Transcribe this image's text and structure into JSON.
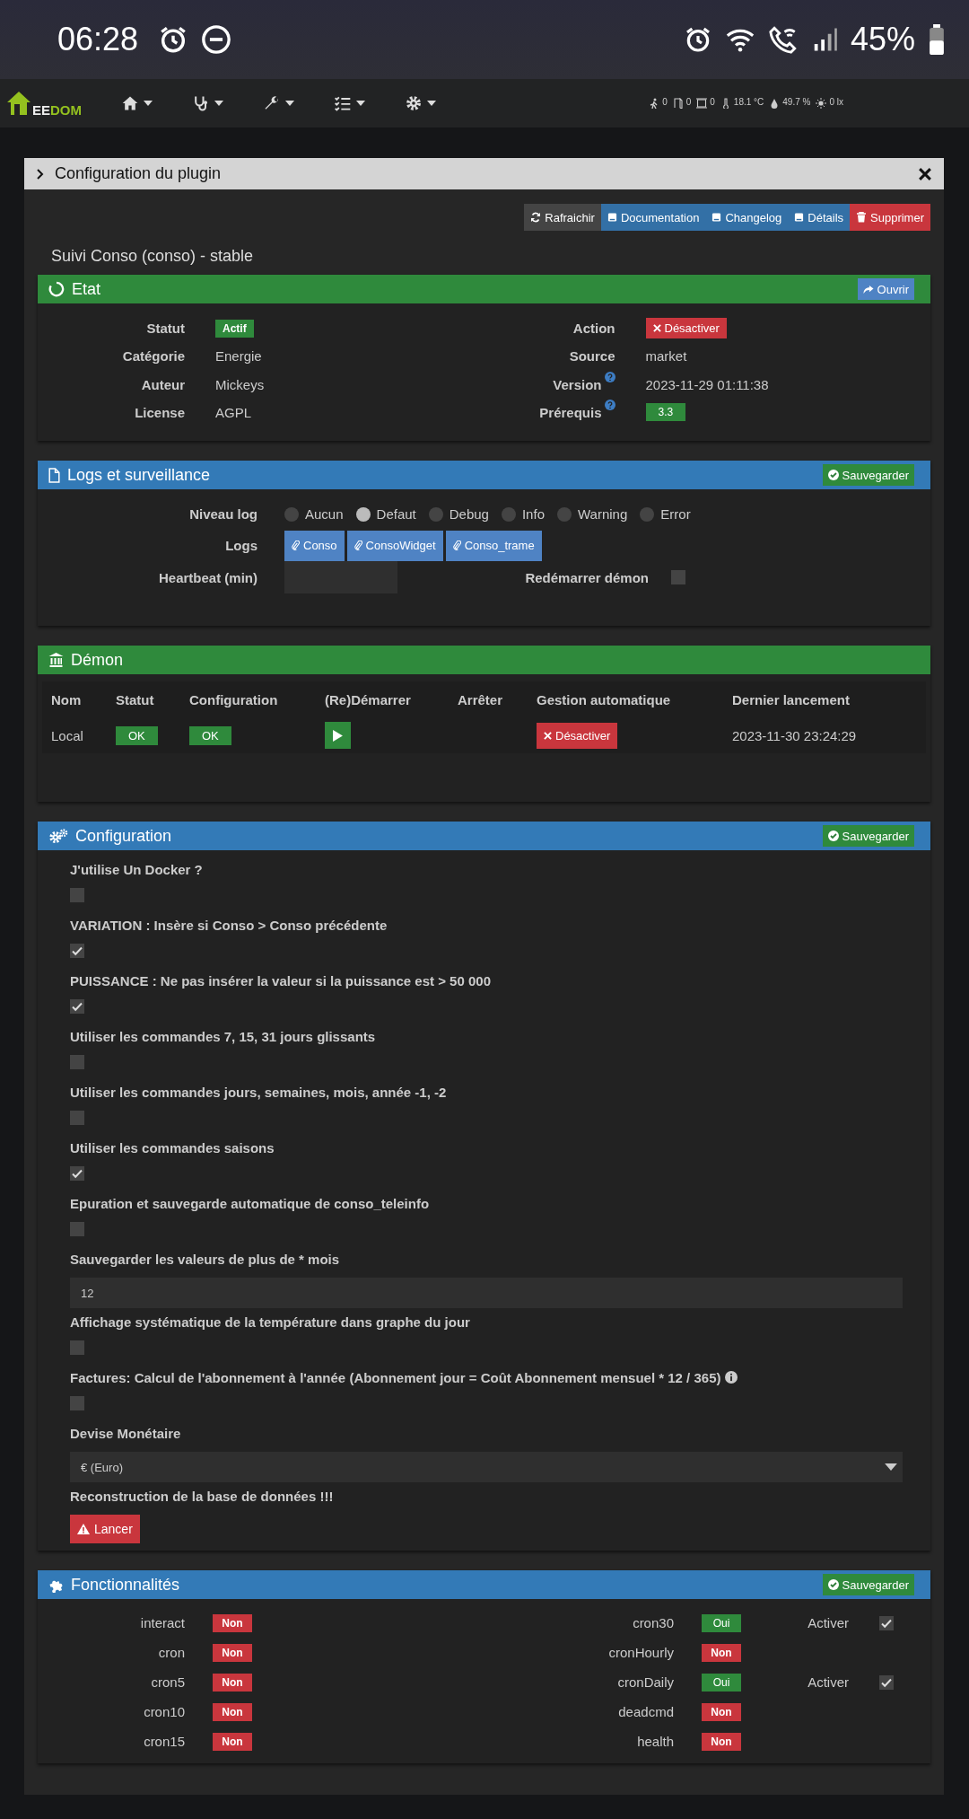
{
  "status_bar": {
    "time": "06:28",
    "battery_text": "45%"
  },
  "navbar": {
    "logo": {
      "light": "EE",
      "accent": "DOM"
    },
    "menus": [
      {
        "kind": "home"
      },
      {
        "kind": "health"
      },
      {
        "kind": "tools"
      },
      {
        "kind": "list"
      },
      {
        "kind": "settings"
      }
    ],
    "widgets": [
      {
        "kind": "motion",
        "text": "0"
      },
      {
        "kind": "door",
        "text": "0"
      },
      {
        "kind": "window",
        "text": "0"
      },
      {
        "kind": "temperature",
        "text": "18.1 °C"
      },
      {
        "kind": "humidity",
        "text": "49.7 %"
      },
      {
        "kind": "light",
        "text": "0 lx"
      }
    ]
  },
  "modal": {
    "title": "Configuration du plugin",
    "toolbar": [
      {
        "label": "Rafraichir",
        "kind": "refresh"
      },
      {
        "label": "Documentation",
        "kind": "doc"
      },
      {
        "label": "Changelog",
        "kind": "doc"
      },
      {
        "label": "Détails",
        "kind": "doc"
      },
      {
        "label": "Supprimer",
        "kind": "delete"
      }
    ],
    "plugin_title": "Suivi Conso (conso) - stable",
    "etat": {
      "title": "Etat",
      "button": "Ouvrir",
      "left": [
        {
          "label": "Statut",
          "value": "Actif",
          "kind": "badge"
        },
        {
          "label": "Catégorie",
          "value": "Energie",
          "kind": "text"
        },
        {
          "label": "Auteur",
          "value": "Mickeys",
          "kind": "text"
        },
        {
          "label": "License",
          "value": "AGPL",
          "kind": "text"
        }
      ],
      "right": [
        {
          "label": "Action",
          "value": "Désactiver",
          "kind": "button",
          "help": false
        },
        {
          "label": "Source",
          "value": "market",
          "kind": "text",
          "help": false
        },
        {
          "label": "Version",
          "value": "2023-11-29 01:11:38",
          "kind": "text",
          "help": true
        },
        {
          "label": "Prérequis",
          "value": "3.3",
          "kind": "badge",
          "help": true
        }
      ]
    },
    "logs": {
      "title": "Logs et surveillance",
      "button": "Sauvegarder",
      "level_label": "Niveau log",
      "levels": [
        {
          "label": "Aucun",
          "selected": false
        },
        {
          "label": "Defaut",
          "selected": true
        },
        {
          "label": "Debug",
          "selected": false
        },
        {
          "label": "Info",
          "selected": false
        },
        {
          "label": "Warning",
          "selected": false
        },
        {
          "label": "Error",
          "selected": false
        }
      ],
      "logs_label": "Logs",
      "log_buttons": [
        "Conso",
        "ConsoWidget",
        "Conso_trame"
      ],
      "heartbeat_label": "Heartbeat (min)",
      "restart_label": "Redémarrer démon",
      "restart_checked": false
    },
    "demon": {
      "title": "Démon",
      "columns": [
        "Nom",
        "Statut",
        "Configuration",
        "(Re)Démarrer",
        "Arrêter",
        "Gestion automatique",
        "Dernier lancement"
      ],
      "row": {
        "name": "Local",
        "status": "OK",
        "config": "OK",
        "auto_button": "Désactiver",
        "last_launch": "2023-11-30 23:24:29"
      }
    },
    "configuration": {
      "title": "Configuration",
      "button": "Sauvegarder",
      "items": [
        {
          "kind": "checkbox",
          "label": "J'utilise Un Docker ?",
          "checked": false,
          "info": false
        },
        {
          "kind": "checkbox",
          "label": "VARIATION : Insère si Conso > Conso précédente",
          "checked": true,
          "info": false
        },
        {
          "kind": "checkbox",
          "label": "PUISSANCE : Ne pas insérer la valeur si la puissance est > 50 000",
          "checked": true,
          "info": false
        },
        {
          "kind": "checkbox",
          "label": "Utiliser les commandes 7, 15, 31 jours glissants",
          "checked": false,
          "info": false
        },
        {
          "kind": "checkbox",
          "label": "Utiliser les commandes jours, semaines, mois, année -1, -2",
          "checked": false,
          "info": false
        },
        {
          "kind": "checkbox",
          "label": "Utiliser les commandes saisons",
          "checked": true,
          "info": false
        },
        {
          "kind": "checkbox",
          "label": "Epuration et sauvegarde automatique de conso_teleinfo",
          "checked": false,
          "info": false
        },
        {
          "kind": "input",
          "label": "Sauvegarder les valeurs de plus de * mois",
          "value": "12"
        },
        {
          "kind": "checkbox",
          "label": "Affichage systématique de la température dans graphe du jour",
          "checked": false,
          "info": false
        },
        {
          "kind": "checkbox",
          "label": "Factures: Calcul de l'abonnement à l'année (Abonnement jour = Coût Abonnement mensuel * 12 / 365)",
          "checked": false,
          "info": true
        },
        {
          "kind": "select",
          "label": "Devise Monétaire",
          "value": "€ (Euro)"
        },
        {
          "kind": "button",
          "label": "Reconstruction de la base de données !!!",
          "button": "Lancer"
        }
      ]
    },
    "features": {
      "title": "Fonctionnalités",
      "button": "Sauvegarder",
      "left": [
        {
          "name": "interact",
          "value": "Non",
          "on": false
        },
        {
          "name": "cron",
          "value": "Non",
          "on": false
        },
        {
          "name": "cron5",
          "value": "Non",
          "on": false
        },
        {
          "name": "cron10",
          "value": "Non",
          "on": false
        },
        {
          "name": "cron15",
          "value": "Non",
          "on": false
        }
      ],
      "right": [
        {
          "name": "cron30",
          "value": "Oui",
          "on": true,
          "activer": "Activer",
          "checked": true
        },
        {
          "name": "cronHourly",
          "value": "Non",
          "on": false
        },
        {
          "name": "cronDaily",
          "value": "Oui",
          "on": true,
          "activer": "Activer",
          "checked": true
        },
        {
          "name": "deadcmd",
          "value": "Non",
          "on": false
        },
        {
          "name": "health",
          "value": "Non",
          "on": false
        }
      ]
    }
  }
}
